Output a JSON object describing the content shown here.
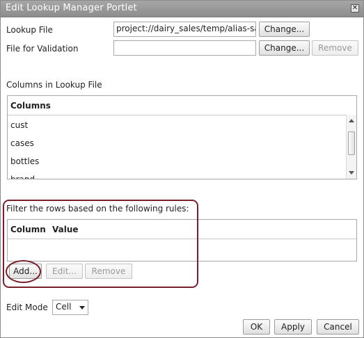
{
  "window": {
    "title": "Edit Lookup Manager Portlet"
  },
  "lookup_file": {
    "label": "Lookup File",
    "value": "project://dairy_sales/temp/alias-sa",
    "change_label": "Change..."
  },
  "validation_file": {
    "label": "File for Validation",
    "value": "",
    "change_label": "Change...",
    "remove_label": "Remove"
  },
  "columns_section": {
    "label": "Columns in Lookup File",
    "header": "Columns",
    "items": [
      "cust",
      "cases",
      "bottles",
      "brand"
    ]
  },
  "filter_section": {
    "label": "Filter the rows based on the following rules:",
    "column_header": "Column",
    "value_header": "Value",
    "add_label": "Add...",
    "edit_label": "Edit...",
    "remove_label": "Remove"
  },
  "edit_mode": {
    "label": "Edit Mode",
    "value": "Cell"
  },
  "footer": {
    "ok_label": "OK",
    "apply_label": "Apply",
    "cancel_label": "Cancel"
  },
  "annotation_color": "#7a1f2a"
}
